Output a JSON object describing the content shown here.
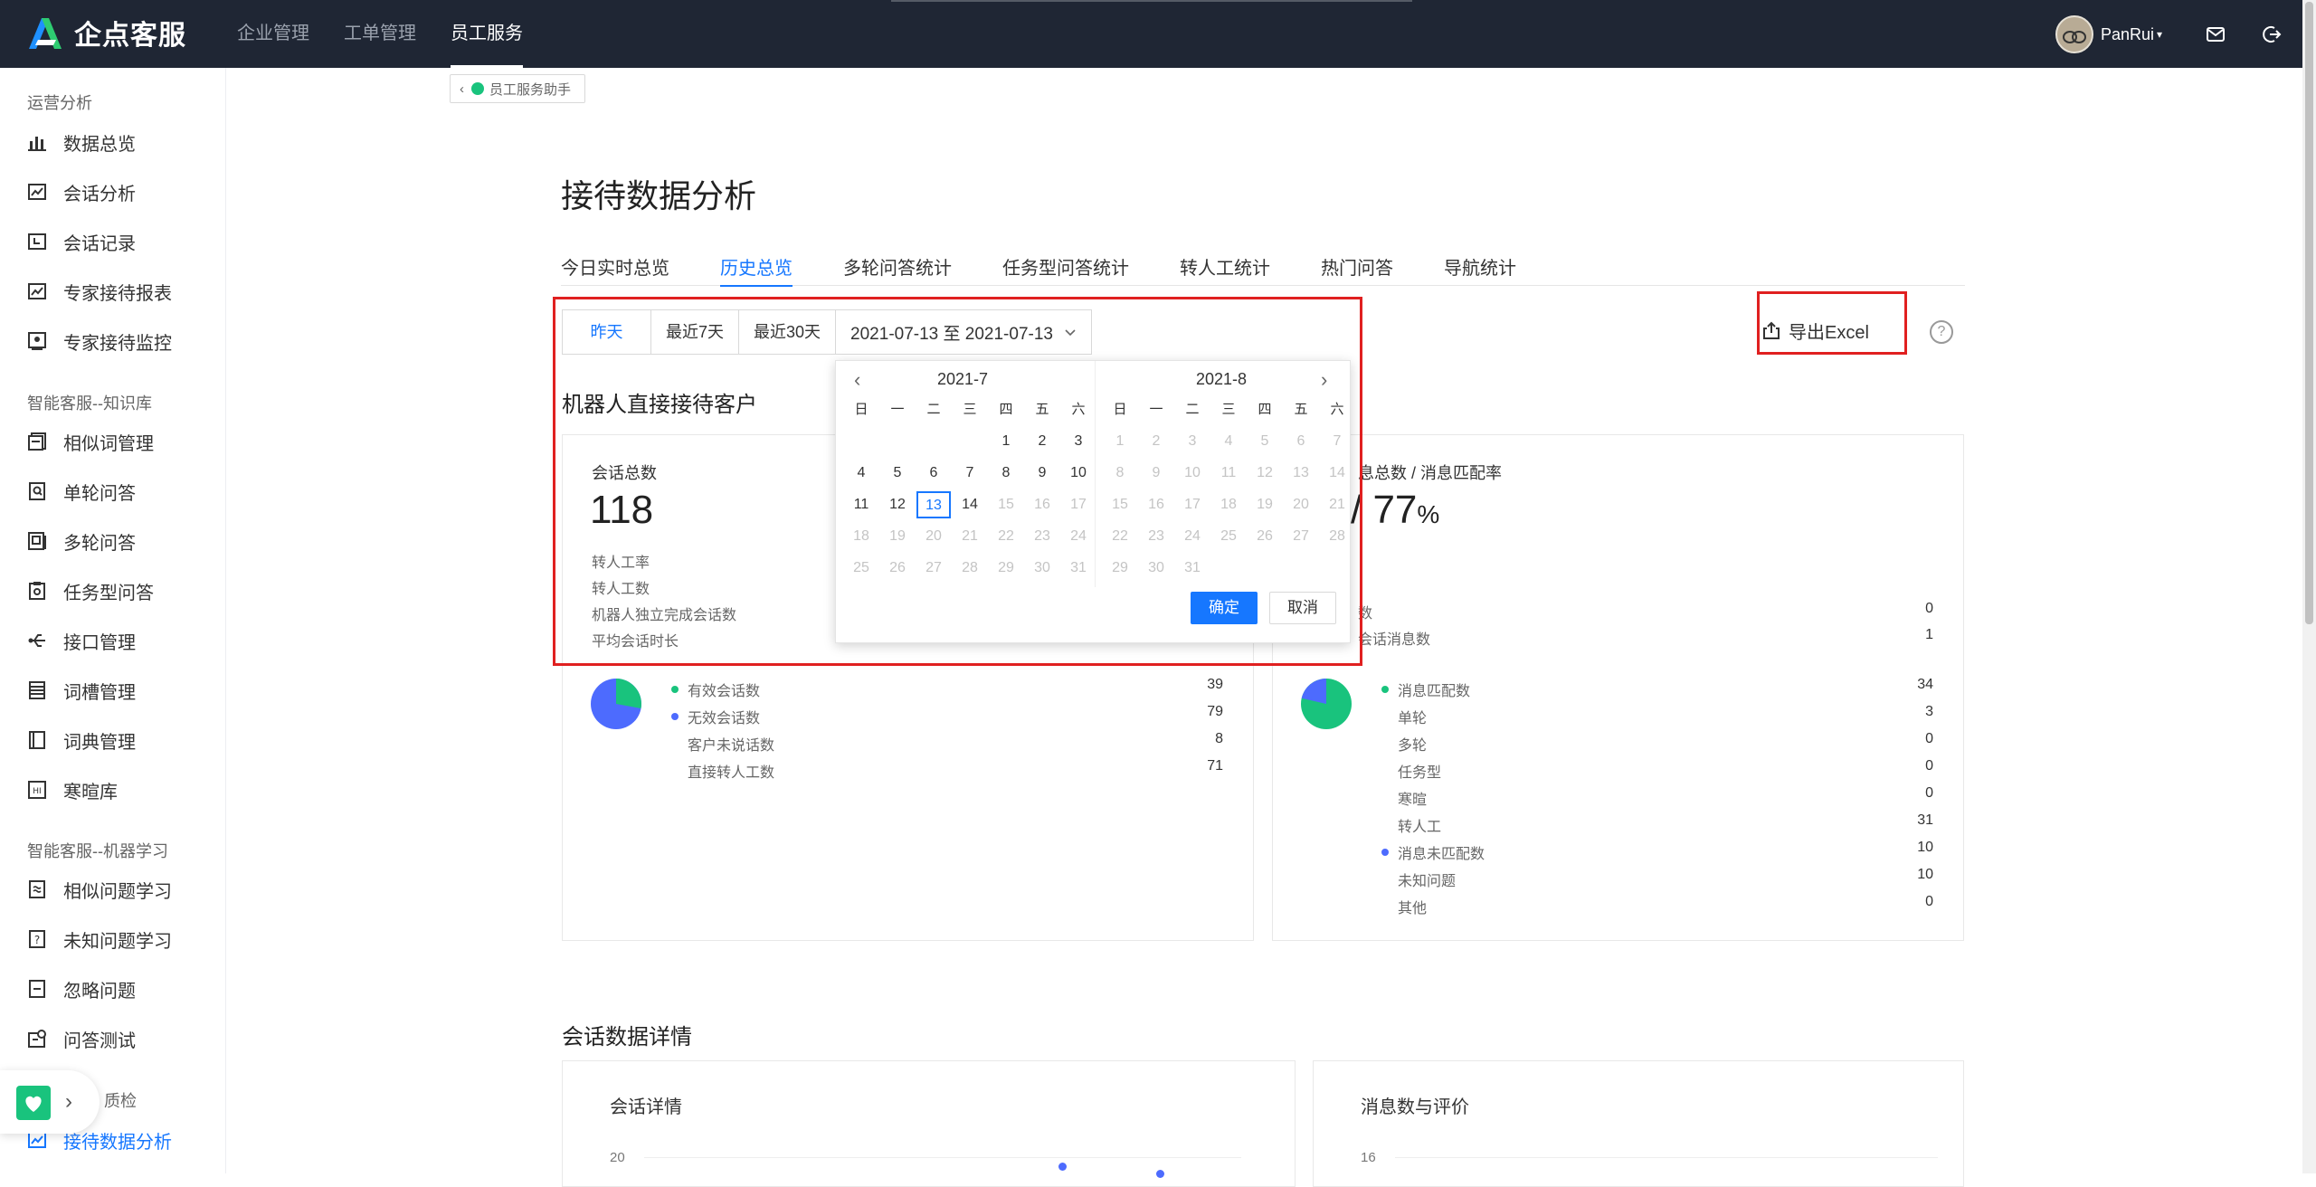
{
  "brand": {
    "name": "企点客服"
  },
  "topnav": {
    "items": [
      "企业管理",
      "工单管理",
      "员工服务"
    ],
    "active_index": 2
  },
  "user": {
    "name": "PanRui"
  },
  "sidebar": {
    "groups": [
      {
        "title": "运营分析",
        "items": [
          {
            "label": "数据总览",
            "icon": "bar-chart-icon"
          },
          {
            "label": "会话分析",
            "icon": "trend-icon"
          },
          {
            "label": "会话记录",
            "icon": "clock-icon"
          },
          {
            "label": "专家接待报表",
            "icon": "trend-icon"
          },
          {
            "label": "专家接待监控",
            "icon": "monitor-icon"
          }
        ]
      },
      {
        "title": "智能客服--知识库",
        "items": [
          {
            "label": "相似词管理",
            "icon": "docs-icon"
          },
          {
            "label": "单轮问答",
            "icon": "qa-icon"
          },
          {
            "label": "多轮问答",
            "icon": "multi-qa-icon"
          },
          {
            "label": "任务型问答",
            "icon": "task-icon"
          },
          {
            "label": "接口管理",
            "icon": "usb-icon"
          },
          {
            "label": "词槽管理",
            "icon": "list-icon"
          },
          {
            "label": "词典管理",
            "icon": "book-icon"
          },
          {
            "label": "寒暄库",
            "icon": "hi-icon"
          }
        ]
      },
      {
        "title": "智能客服--机器学习",
        "items": [
          {
            "label": "相似问题学习",
            "icon": "similar-icon"
          },
          {
            "label": "未知问题学习",
            "icon": "question-icon"
          },
          {
            "label": "忽略问题",
            "icon": "ignore-icon"
          },
          {
            "label": "问答测试",
            "icon": "test-icon"
          }
        ]
      },
      {
        "title": "质检",
        "items": [
          {
            "label": "接待数据分析",
            "icon": "analysis-icon",
            "active": true
          }
        ]
      }
    ]
  },
  "crumb": {
    "label": "员工服务助手"
  },
  "page": {
    "title": "接待数据分析"
  },
  "tabs": [
    "今日实时总览",
    "历史总览",
    "多轮问答统计",
    "任务型问答统计",
    "转人工统计",
    "热门问答",
    "导航统计"
  ],
  "tabs_active_index": 1,
  "range": {
    "yesterday": "昨天",
    "last7": "最近7天",
    "last30": "最近30天",
    "value": "2021-07-13 至 2021-07-13"
  },
  "export": {
    "label": "导出Excel"
  },
  "help": {
    "label": "?"
  },
  "robot_section": {
    "title": "机器人直接接待客户"
  },
  "card_left": {
    "label": "会话总数",
    "total": "118",
    "lines": [
      "转人工率",
      "转人工数",
      "机器人独立完成会话数",
      "平均会话时长"
    ],
    "legend": [
      {
        "label": "有效会话数",
        "value": "39",
        "color": "#19c37d"
      },
      {
        "label": "无效会话数",
        "value": "79",
        "color": "#4d6bfe"
      },
      {
        "label": "客户未说话数",
        "value": "8"
      },
      {
        "label": "直接转人工数",
        "value": "71"
      }
    ]
  },
  "card_right": {
    "label_partial": "息总数 / 消息匹配率",
    "big_partial": "/ 77",
    "big_unit": "%",
    "lines": [
      {
        "label": "数",
        "value": "0"
      },
      {
        "label": "会话消息数",
        "value": "1"
      }
    ],
    "legend": [
      {
        "label": "消息匹配数",
        "value": "34",
        "color": "#19c37d"
      },
      {
        "label": "单轮",
        "value": "3"
      },
      {
        "label": "多轮",
        "value": "0"
      },
      {
        "label": "任务型",
        "value": "0"
      },
      {
        "label": "寒暄",
        "value": "0"
      },
      {
        "label": "转人工",
        "value": "31"
      },
      {
        "label": "消息未匹配数",
        "value": "10",
        "color": "#4d6bfe"
      },
      {
        "label": "未知问题",
        "value": "10"
      },
      {
        "label": "其他",
        "value": "0"
      }
    ]
  },
  "picker": {
    "left_title": "2021-7",
    "right_title": "2021-8",
    "weekdays": [
      "日",
      "一",
      "二",
      "三",
      "四",
      "五",
      "六"
    ],
    "july": [
      [
        "",
        "",
        "",
        "",
        "1",
        "2",
        "3"
      ],
      [
        "4",
        "5",
        "6",
        "7",
        "8",
        "9",
        "10"
      ],
      [
        "11",
        "12",
        "13",
        "14",
        "15",
        "16",
        "17"
      ],
      [
        "18",
        "19",
        "20",
        "21",
        "22",
        "23",
        "24"
      ],
      [
        "25",
        "26",
        "27",
        "28",
        "29",
        "30",
        "31"
      ]
    ],
    "august": [
      [
        "1",
        "2",
        "3",
        "4",
        "5",
        "6",
        "7"
      ],
      [
        "8",
        "9",
        "10",
        "11",
        "12",
        "13",
        "14"
      ],
      [
        "15",
        "16",
        "17",
        "18",
        "19",
        "20",
        "21"
      ],
      [
        "22",
        "23",
        "24",
        "25",
        "26",
        "27",
        "28"
      ],
      [
        "29",
        "30",
        "31",
        "",
        "",
        "",
        ""
      ]
    ],
    "selected": "13",
    "ok": "确定",
    "cancel": "取消"
  },
  "detail_section": {
    "title": "会话数据详情"
  },
  "detail_cards": [
    {
      "title": "会话详情",
      "tick": "20"
    },
    {
      "title": "消息数与评价",
      "tick": "16"
    }
  ]
}
